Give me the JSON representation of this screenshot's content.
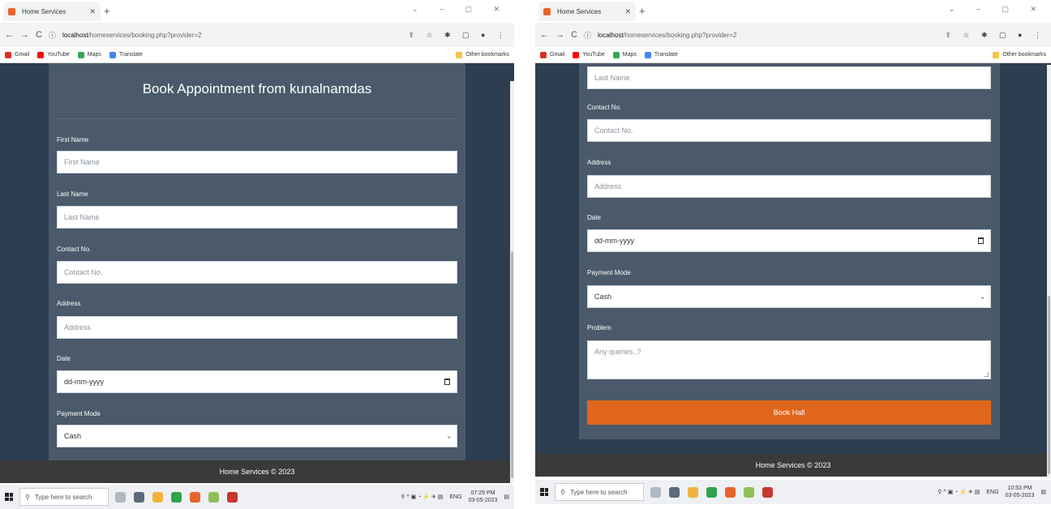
{
  "left": {
    "tab_title": "Home Services",
    "url_host": "localhost",
    "url_path": "/homeservices/booking.php?provider=2",
    "bookmarks": [
      {
        "label": "Gmail",
        "color": "#d93025"
      },
      {
        "label": "YouTube",
        "color": "#ff0000"
      },
      {
        "label": "Maps",
        "color": "#34a853"
      },
      {
        "label": "Translate",
        "color": "#4285f4"
      }
    ],
    "other_bookmarks": "Other bookmarks",
    "heading": "Book Appointment from kunalnamdas",
    "fields": [
      {
        "label": "First Name",
        "placeholder": "First Name"
      },
      {
        "label": "Last Name",
        "placeholder": "Last Name"
      },
      {
        "label": "Contact No.",
        "placeholder": "Contact No."
      },
      {
        "label": "Address",
        "placeholder": "Address"
      },
      {
        "label": "Date",
        "value": "dd-mm-yyyy"
      },
      {
        "label": "Payment Mode",
        "value": "Cash"
      }
    ],
    "footer": "Home Services © 2023",
    "taskbar": {
      "search": "Type here to search",
      "lang": "ENG",
      "time": "07:29 PM",
      "date": "03-05-2023"
    }
  },
  "right": {
    "tab_title": "Home Services",
    "url_host": "localhost",
    "url_path": "/homeservices/booking.php?provider=2",
    "bookmarks": [
      {
        "label": "Gmail",
        "color": "#d93025"
      },
      {
        "label": "YouTube",
        "color": "#ff0000"
      },
      {
        "label": "Maps",
        "color": "#34a853"
      },
      {
        "label": "Translate",
        "color": "#4285f4"
      }
    ],
    "other_bookmarks": "Other bookmarks",
    "fields": [
      {
        "label": "",
        "placeholder": "Last Name"
      },
      {
        "label": "Contact No.",
        "placeholder": "Contact No."
      },
      {
        "label": "Address",
        "placeholder": "Address"
      },
      {
        "label": "Date",
        "value": "dd-mm-yyyy"
      },
      {
        "label": "Payment Mode",
        "value": "Cash"
      },
      {
        "label": "Problem",
        "placeholder": "Any queries..?"
      }
    ],
    "button": "Book Hall",
    "footer": "Home Services © 2023",
    "taskbar": {
      "search": "Type here to search",
      "lang": "ENG",
      "time": "10:53 PM",
      "date": "03-05-2023"
    }
  },
  "colors": {
    "page_bg": "#2c3e50",
    "card_bg": "#4a5a6a",
    "accent": "#e0661e",
    "footer_bg": "#3a3a3a"
  }
}
